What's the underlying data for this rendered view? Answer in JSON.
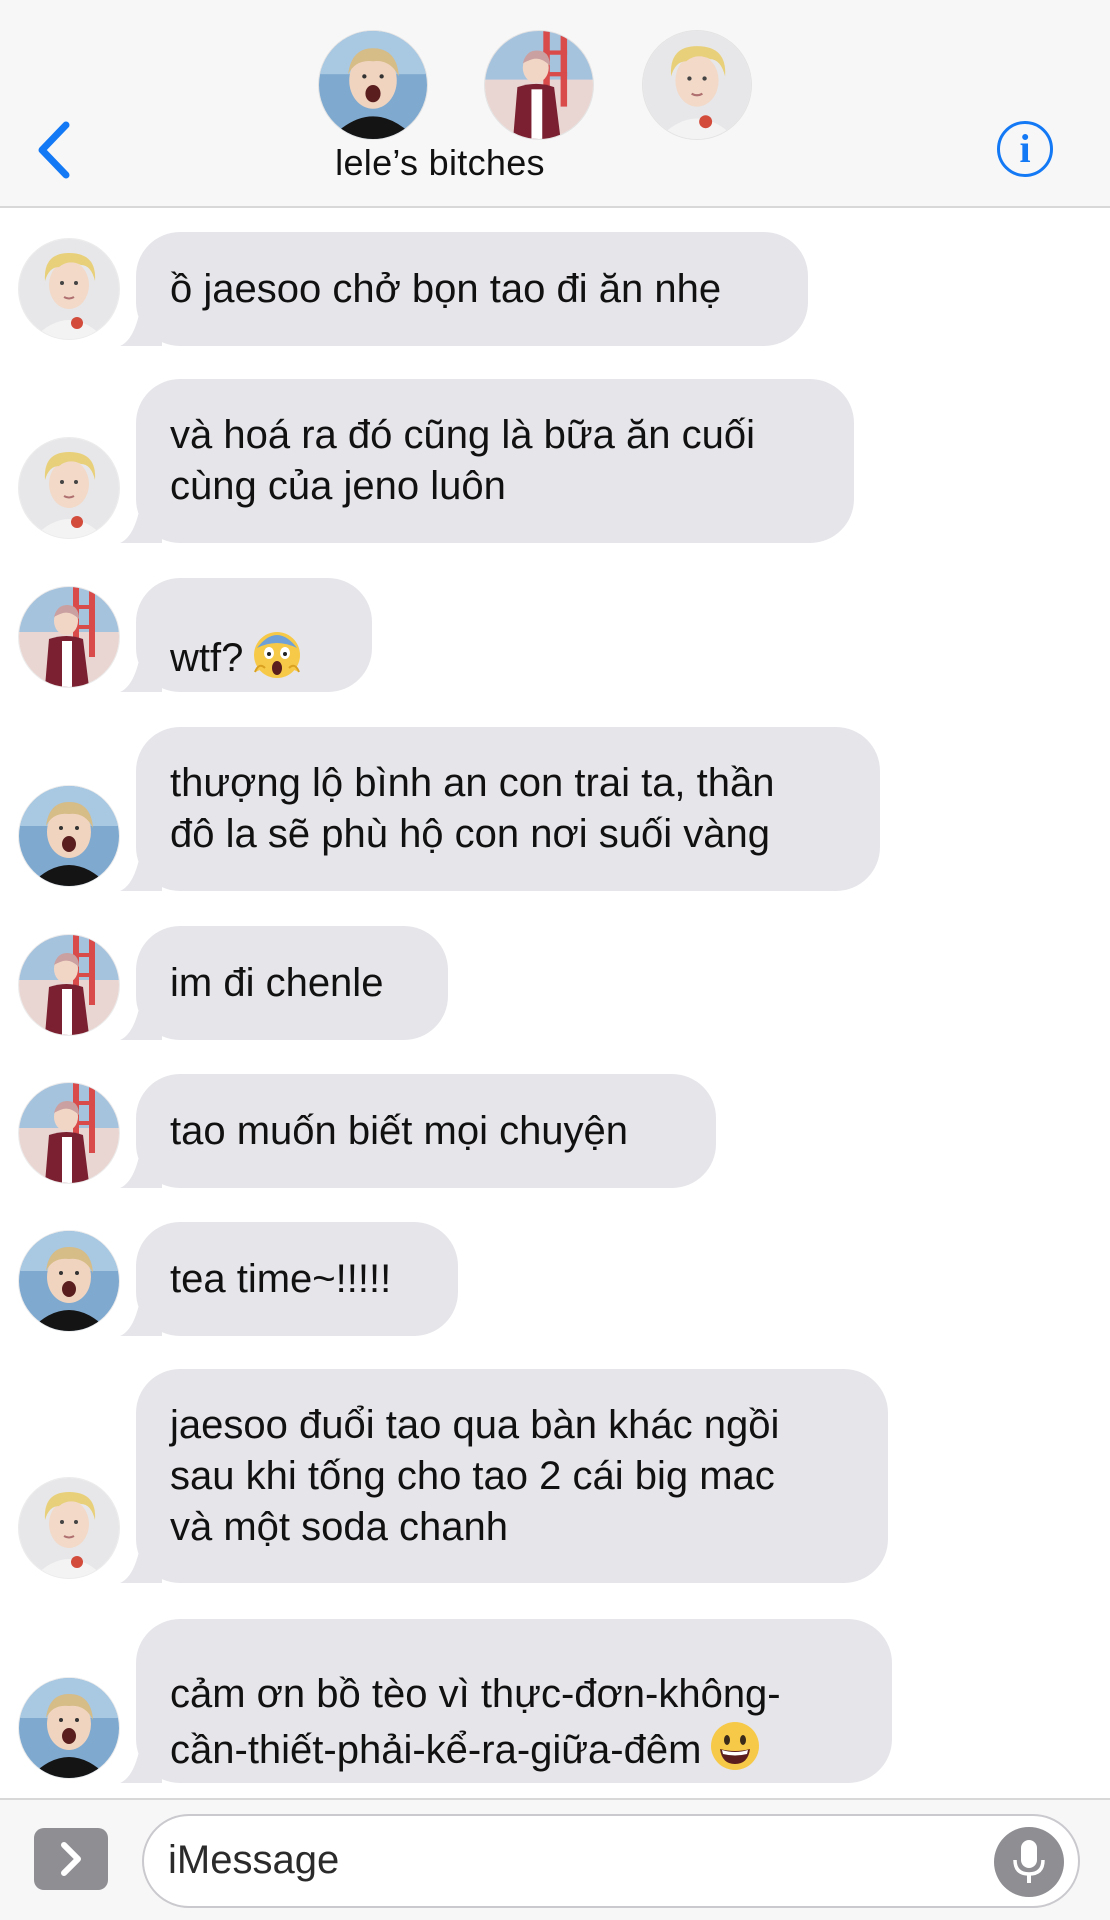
{
  "header": {
    "group_name": "lele’s bitches",
    "back_icon": "chevron-left-icon",
    "info_icon": "info-icon",
    "accent_color": "#1479f5"
  },
  "messages": [
    {
      "sender": "yellow-hair",
      "text": "ồ jaesoo chở bọn tao đi ăn nhẹ"
    },
    {
      "sender": "yellow-hair",
      "text": "và hoá ra đó cũng là bữa ăn cuối\ncùng của jeno luôn"
    },
    {
      "sender": "plaid-shirt",
      "text": "wtf?",
      "emoji": "screaming-face-emoji"
    },
    {
      "sender": "laughing",
      "text": "thượng lộ bình an con trai ta, thần\nđô la sẽ phù hộ con nơi suối vàng"
    },
    {
      "sender": "plaid-shirt",
      "text": "im đi chenle"
    },
    {
      "sender": "plaid-shirt",
      "text": "tao muốn biết mọi chuyện"
    },
    {
      "sender": "laughing",
      "text": "tea time~!!!!!"
    },
    {
      "sender": "yellow-hair",
      "text": "jaesoo đuổi tao qua bàn khác ngồi\nsau khi tống cho tao 2 cái big mac\nvà một soda chanh"
    },
    {
      "sender": "laughing",
      "text": "cảm ơn bồ tèo vì thực-đơn-không-\ncần-thiết-phải-kể-ra-giữa-đêm",
      "emoji": "grinning-face-emoji"
    }
  ],
  "input": {
    "placeholder": "iMessage",
    "apps_icon": "chevron-right-icon",
    "mic_icon": "microphone-icon"
  },
  "colors": {
    "bubble": "#e6e5ea",
    "header_bg": "#f7f7f7",
    "apps_button": "#8e8e93"
  }
}
